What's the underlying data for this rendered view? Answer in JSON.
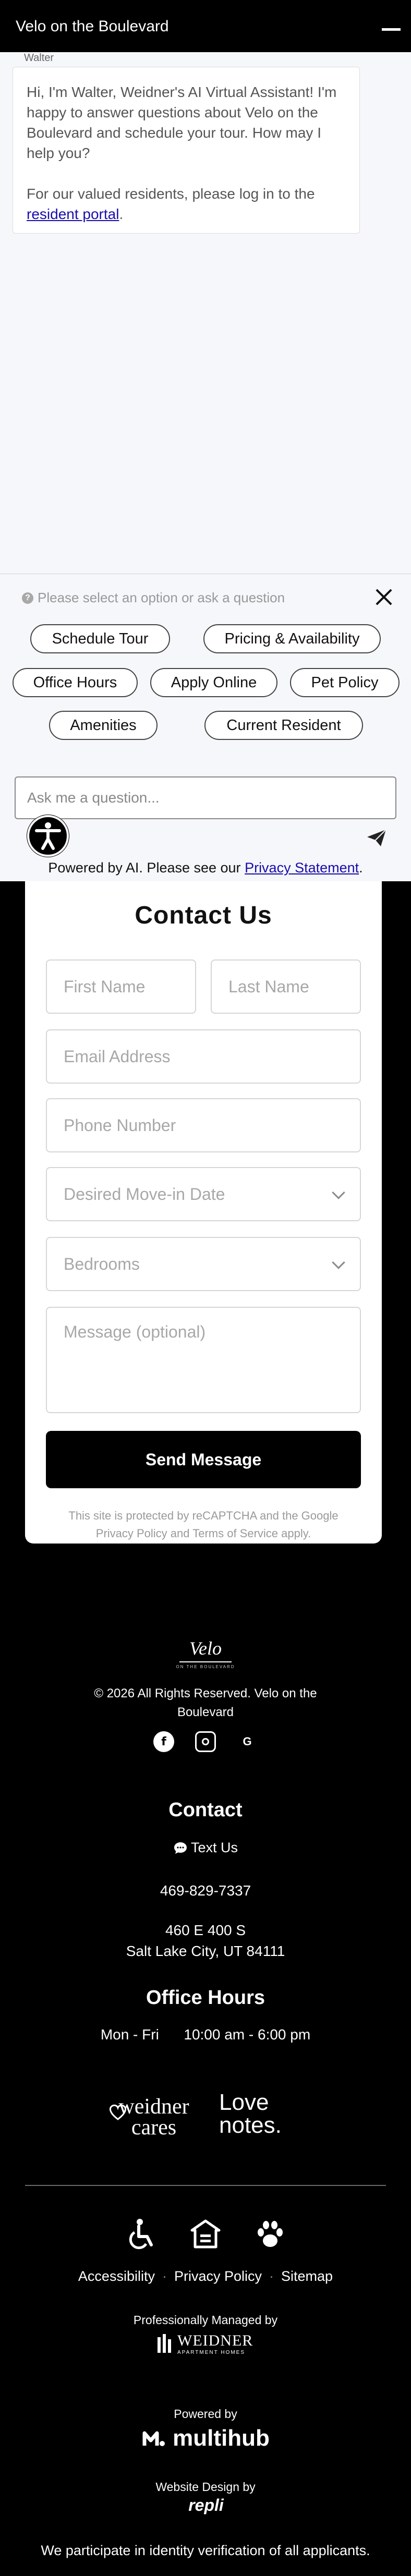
{
  "chat": {
    "title": "Velo on the Boulevard",
    "sender": "Walter",
    "greeting": "Hi, I'm Walter, Weidner's AI Virtual Assistant! I'm happy to answer questions about Velo on the Boulevard and schedule your tour. How may I help you?",
    "resident_prefix": "For our valued residents, please log in to the ",
    "resident_link": "resident portal",
    "resident_suffix": ".",
    "prompt": "Please select an option or ask a question",
    "options": [
      "Schedule Tour",
      "Pricing & Availability",
      "Office Hours",
      "Apply Online",
      "Pet Policy",
      "Amenities",
      "Current Resident"
    ],
    "input_placeholder": "Ask me a question...",
    "powered_prefix": "Powered by AI. Please see our ",
    "powered_link": "Privacy Statement",
    "powered_suffix": "."
  },
  "contact_form": {
    "title": "Contact Us",
    "first_name": "First Name",
    "last_name": "Last Name",
    "email": "Email Address",
    "phone": "Phone Number",
    "move_in": "Desired Move-in Date",
    "bedrooms": "Bedrooms",
    "message": "Message (optional)",
    "submit": "Send Message",
    "recaptcha_line1": "This site is protected by reCAPTCHA and the Google",
    "recaptcha_line2": "Privacy Policy and Terms of Service apply."
  },
  "footer": {
    "logo_word": "Velo",
    "logo_sub": "ON THE BOULEVARD",
    "copyright_line1": "© 2026 All Rights Reserved. Velo on the",
    "copyright_line2": "Boulevard",
    "social_icons": [
      "facebook-icon",
      "instagram-icon",
      "google-icon"
    ],
    "contact_heading": "Contact",
    "text_us": "Text Us",
    "phone": "469-829-7337",
    "address_line1": "460 E 400 S",
    "address_line2": "Salt Lake City, UT 84111",
    "hours_heading": "Office Hours",
    "hours_days": "Mon - Fri",
    "hours_time": "10:00 am - 6:00 pm",
    "weidner_cares_line1": "weidner",
    "weidner_cares_line2": "cares",
    "love_notes_line1": "Love",
    "love_notes_line2": "notes.",
    "links": [
      "Accessibility",
      "Privacy Policy",
      "Sitemap"
    ],
    "managed_by": "Professionally Managed by",
    "weidner_logo": "WEIDNER",
    "weidner_logo_sub": "APARTMENT HOMES",
    "powered_by": "Powered by",
    "multihub": "multihub",
    "design_by": "Website Design by",
    "repli": "repli",
    "identity_note": "We participate in identity verification of all applicants."
  }
}
